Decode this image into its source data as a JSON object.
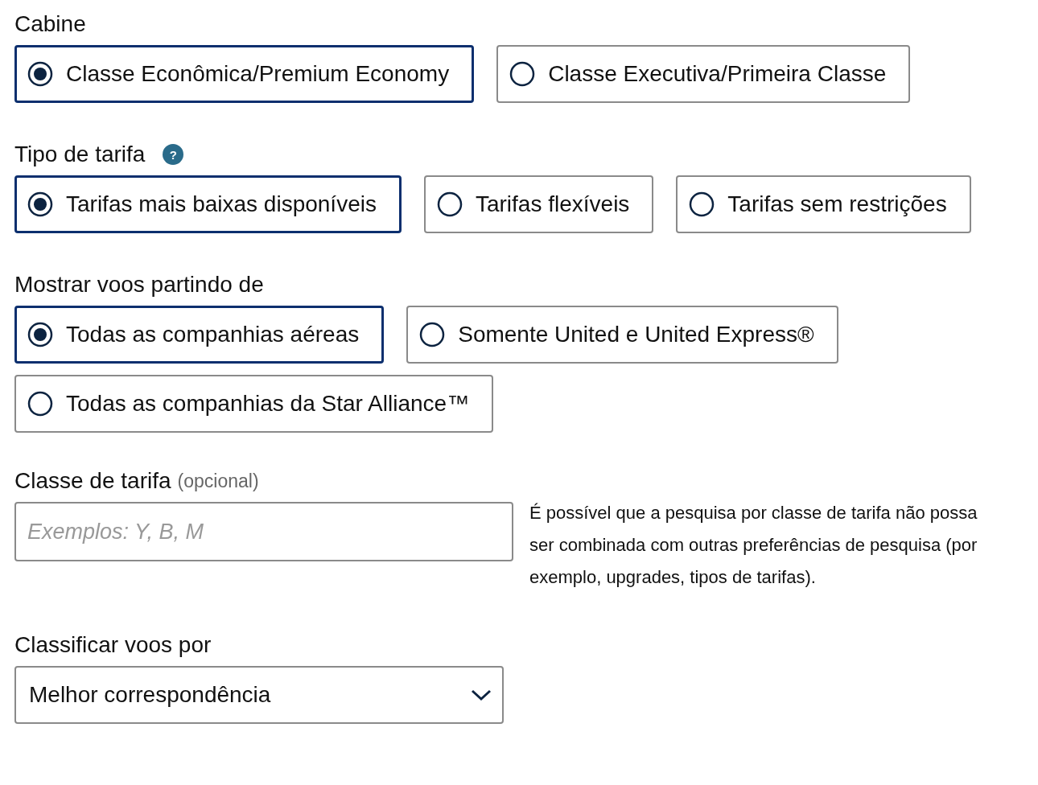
{
  "sections": [
    {
      "kind": "radio",
      "label": "Cabine",
      "options": [
        {
          "label": "Classe Econômica/Premium Economy",
          "selected": true
        },
        {
          "label": "Classe Executiva/Primeira Classe",
          "selected": false
        }
      ]
    },
    {
      "kind": "radio",
      "label": "Tipo de tarifa",
      "help": "?",
      "options": [
        {
          "label": "Tarifas mais baixas disponíveis",
          "selected": true
        },
        {
          "label": "Tarifas flexíveis",
          "selected": false
        },
        {
          "label": "Tarifas sem restrições",
          "selected": false
        }
      ]
    },
    {
      "kind": "radio",
      "label": "Mostrar voos partindo de",
      "options": [
        {
          "label": "Todas as companhias aéreas",
          "selected": true
        },
        {
          "label": "Somente United e United Express®",
          "selected": false
        },
        {
          "label": "Todas as companhias da Star Alliance™",
          "selected": false
        }
      ]
    },
    {
      "kind": "text",
      "label": "Classe de tarifa",
      "label_note": "(opcional)",
      "placeholder": "Exemplos: Y, B, M",
      "note": "É possível que a pesquisa por classe de tarifa não possa ser combinada com outras preferências de pesquisa (por exemplo, upgrades, tipos de tarifas)."
    },
    {
      "kind": "select",
      "label": "Classificar voos por",
      "value": "Melhor correspondência"
    }
  ]
}
